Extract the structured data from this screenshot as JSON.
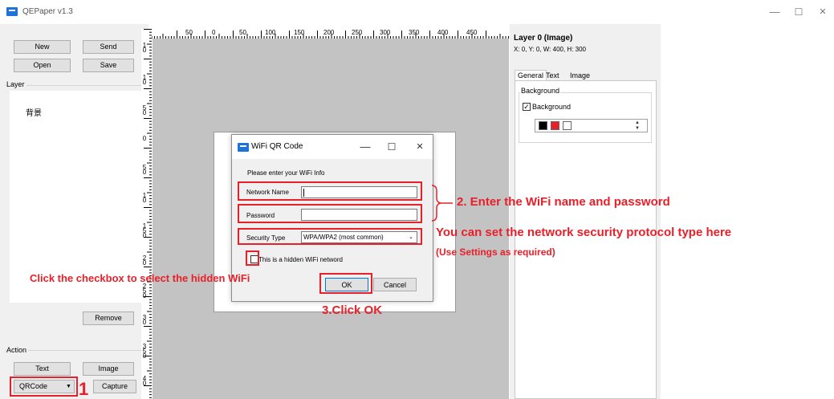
{
  "window": {
    "title": "QEPaper v1.3",
    "minimize_glyph": "—",
    "maximize_glyph": "☐",
    "close_glyph": "✕"
  },
  "left_panel": {
    "new_label": "New",
    "send_label": "Send",
    "open_label": "Open",
    "save_label": "Save",
    "layer_group_label": "Layer",
    "layers": [
      "背景"
    ],
    "remove_label": "Remove",
    "action_group_label": "Action",
    "text_label": "Text",
    "image_label": "Image",
    "qrcode_label": "QRCode",
    "capture_label": "Capture"
  },
  "ruler": {
    "top_labels": [
      "50",
      "0",
      "50",
      "100",
      "150",
      "200",
      "250",
      "300",
      "350",
      "400",
      "450"
    ],
    "left_labels": [
      "1\n0",
      "1\n0",
      "5\n0",
      "0",
      "5\n0",
      "1\n0",
      "1\n5\n0",
      "2\n0",
      "2\n5\n0",
      "3\n0",
      "3\n5\n0",
      "4\n0"
    ]
  },
  "right_panel": {
    "layer_title": "Layer 0 (Image)",
    "layer_info": "X: 0, Y: 0, W: 400, H: 300",
    "tabs": [
      "General",
      "Text",
      "Image"
    ],
    "background_group_label": "Background",
    "background_checkbox_label": "Background",
    "background_checked": true,
    "swatch_colors": [
      "#000000",
      "#e8202a",
      "#ffffff"
    ],
    "spin_up": "▲",
    "spin_down": "▼"
  },
  "dialog": {
    "title": "WiFi QR Code",
    "minimize_glyph": "—",
    "maximize_glyph": "☐",
    "close_glyph": "✕",
    "prompt": "Please enter your WiFi Info",
    "network_name_label": "Network Name",
    "network_name_value": "",
    "password_label": "Password",
    "password_value": "",
    "security_type_label": "Security Type",
    "security_type_value": "WPA/WPA2 (most common)",
    "hidden_checkbox_label": "This is a hidden WiFi netword",
    "hidden_checked": false,
    "ok_label": "OK",
    "cancel_label": "Cancel"
  },
  "annotations": {
    "step1": "1",
    "step2": "2. Enter the WiFi name and password",
    "security_note": "You can set the network security protocol type here",
    "security_subnote": "(Use Settings as required)",
    "checkbox_note": "Click the checkbox to select the hidden WiFi",
    "step3": "3.Click OK",
    "color": "#e8202a"
  }
}
